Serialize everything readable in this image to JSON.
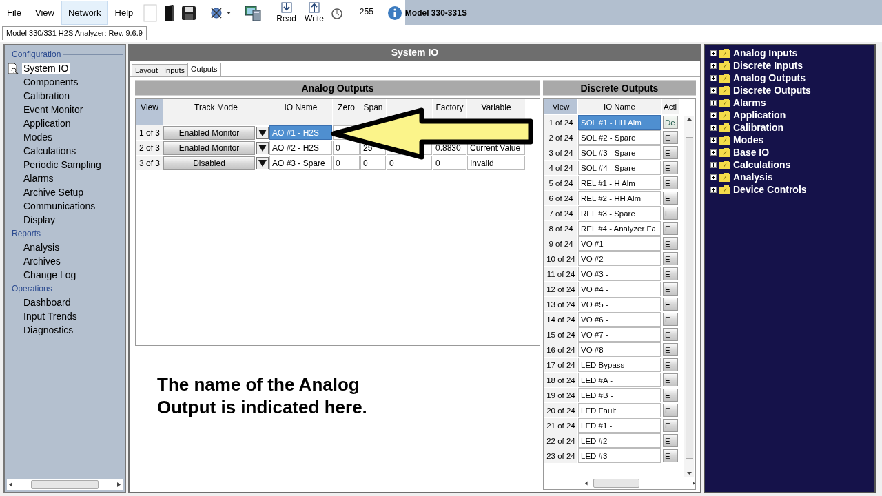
{
  "menu": [
    {
      "label": "File",
      "selected": false
    },
    {
      "label": "View",
      "selected": false
    },
    {
      "label": "Network",
      "selected": true
    },
    {
      "label": "Help",
      "selected": false
    }
  ],
  "toolbar": {
    "read": "Read",
    "write": "Write",
    "count": "255",
    "model": "Model 330-331S"
  },
  "document_tab": "Model 330/331 H2S Analyzer: Rev. 9.6.9",
  "sidebar": {
    "sections": [
      {
        "title": "Configuration",
        "items": [
          {
            "label": "System IO",
            "selected": true
          },
          {
            "label": "Components",
            "selected": false
          },
          {
            "label": "Calibration",
            "selected": false
          },
          {
            "label": "Event Monitor",
            "selected": false
          },
          {
            "label": "Application",
            "selected": false
          },
          {
            "label": "Modes",
            "selected": false
          },
          {
            "label": "Calculations",
            "selected": false
          },
          {
            "label": "Periodic Sampling",
            "selected": false
          },
          {
            "label": "Alarms",
            "selected": false
          },
          {
            "label": "Archive Setup",
            "selected": false
          },
          {
            "label": "Communications",
            "selected": false
          },
          {
            "label": "Display",
            "selected": false
          }
        ]
      },
      {
        "title": "Reports",
        "items": [
          {
            "label": "Analysis",
            "selected": false
          },
          {
            "label": "Archives",
            "selected": false
          },
          {
            "label": "Change Log",
            "selected": false
          }
        ]
      },
      {
        "title": "Operations",
        "items": [
          {
            "label": "Dashboard",
            "selected": false
          },
          {
            "label": "Input Trends",
            "selected": false
          },
          {
            "label": "Diagnostics",
            "selected": false
          }
        ]
      }
    ]
  },
  "panel": {
    "title": "System IO",
    "tabs": [
      {
        "label": "Layout",
        "selected": false
      },
      {
        "label": "Inputs",
        "selected": false
      },
      {
        "label": "Outputs",
        "selected": true
      }
    ],
    "analog_outputs": {
      "title": "Analog Outputs",
      "columns": [
        "View",
        "Track Mode",
        "IO Name",
        "Zero",
        "Span",
        null,
        "Factory",
        "Variable"
      ],
      "rows": [
        {
          "selected": true,
          "cells": [
            "1 of 3",
            "Enabled Monitor",
            "AO #1 - H2S",
            null,
            null,
            null,
            null,
            null
          ]
        },
        {
          "selected": false,
          "cells": [
            "2 of 3",
            "Enabled Monitor",
            "AO #2 - H2S",
            "0",
            "25",
            null,
            "0.8830",
            "Current Value"
          ]
        },
        {
          "selected": false,
          "cells": [
            "3 of 3",
            "Disabled",
            "AO #3 - Spare",
            "0",
            "0",
            "0",
            "0",
            "Invalid"
          ]
        }
      ]
    },
    "annotation": "The name of the Analog Output is indicated here.",
    "discrete_outputs": {
      "title": "Discrete Outputs",
      "columns": [
        "View",
        "IO Name",
        "Acti"
      ],
      "rows": [
        {
          "view": "1 of 24",
          "name": "SOL #1 - HH Alm",
          "active": "De",
          "selected": true
        },
        {
          "view": "2 of 24",
          "name": "SOL #2 - Spare",
          "active": "E",
          "selected": false
        },
        {
          "view": "3 of 24",
          "name": "SOL #3 - Spare",
          "active": "E",
          "selected": false
        },
        {
          "view": "4 of 24",
          "name": "SOL #4 - Spare",
          "active": "E",
          "selected": false
        },
        {
          "view": "5 of 24",
          "name": "REL #1 - H Alm",
          "active": "E",
          "selected": false
        },
        {
          "view": "6 of 24",
          "name": "REL #2 - HH Alm",
          "active": "E",
          "selected": false
        },
        {
          "view": "7 of 24",
          "name": "REL #3 - Spare",
          "active": "E",
          "selected": false
        },
        {
          "view": "8 of 24",
          "name": "REL #4 - Analyzer Fa",
          "active": "E",
          "selected": false
        },
        {
          "view": "9 of 24",
          "name": "VO #1 -",
          "active": "E",
          "selected": false
        },
        {
          "view": "10 of 24",
          "name": "VO #2 -",
          "active": "E",
          "selected": false
        },
        {
          "view": "11 of 24",
          "name": "VO #3 -",
          "active": "E",
          "selected": false
        },
        {
          "view": "12 of 24",
          "name": "VO #4 -",
          "active": "E",
          "selected": false
        },
        {
          "view": "13 of 24",
          "name": "VO #5 -",
          "active": "E",
          "selected": false
        },
        {
          "view": "14 of 24",
          "name": "VO #6 -",
          "active": "E",
          "selected": false
        },
        {
          "view": "15 of 24",
          "name": "VO #7 -",
          "active": "E",
          "selected": false
        },
        {
          "view": "16 of 24",
          "name": "VO #8 -",
          "active": "E",
          "selected": false
        },
        {
          "view": "17 of 24",
          "name": "LED Bypass",
          "active": "E",
          "selected": false
        },
        {
          "view": "18 of 24",
          "name": "LED #A -",
          "active": "E",
          "selected": false
        },
        {
          "view": "19 of 24",
          "name": "LED #B -",
          "active": "E",
          "selected": false
        },
        {
          "view": "20 of 24",
          "name": "LED Fault",
          "active": "E",
          "selected": false
        },
        {
          "view": "21 of 24",
          "name": "LED #1 -",
          "active": "E",
          "selected": false
        },
        {
          "view": "22 of 24",
          "name": "LED #2 -",
          "active": "E",
          "selected": false
        },
        {
          "view": "23 of 24",
          "name": "LED #3 -",
          "active": "E",
          "selected": false
        }
      ]
    }
  },
  "tree": [
    {
      "label": "Analog Inputs",
      "expanded": false
    },
    {
      "label": "Discrete Inputs",
      "expanded": false
    },
    {
      "label": "Analog Outputs",
      "expanded": false
    },
    {
      "label": "Discrete Outputs",
      "expanded": false
    },
    {
      "label": "Alarms",
      "expanded": false
    },
    {
      "label": "Application",
      "expanded": false
    },
    {
      "label": "Calibration",
      "expanded": false
    },
    {
      "label": "Modes",
      "expanded": false
    },
    {
      "label": "Base IO",
      "expanded": false
    },
    {
      "label": "Calculations",
      "expanded": false
    },
    {
      "label": "Analysis",
      "expanded": false
    },
    {
      "label": "Device Controls",
      "expanded": false
    }
  ]
}
